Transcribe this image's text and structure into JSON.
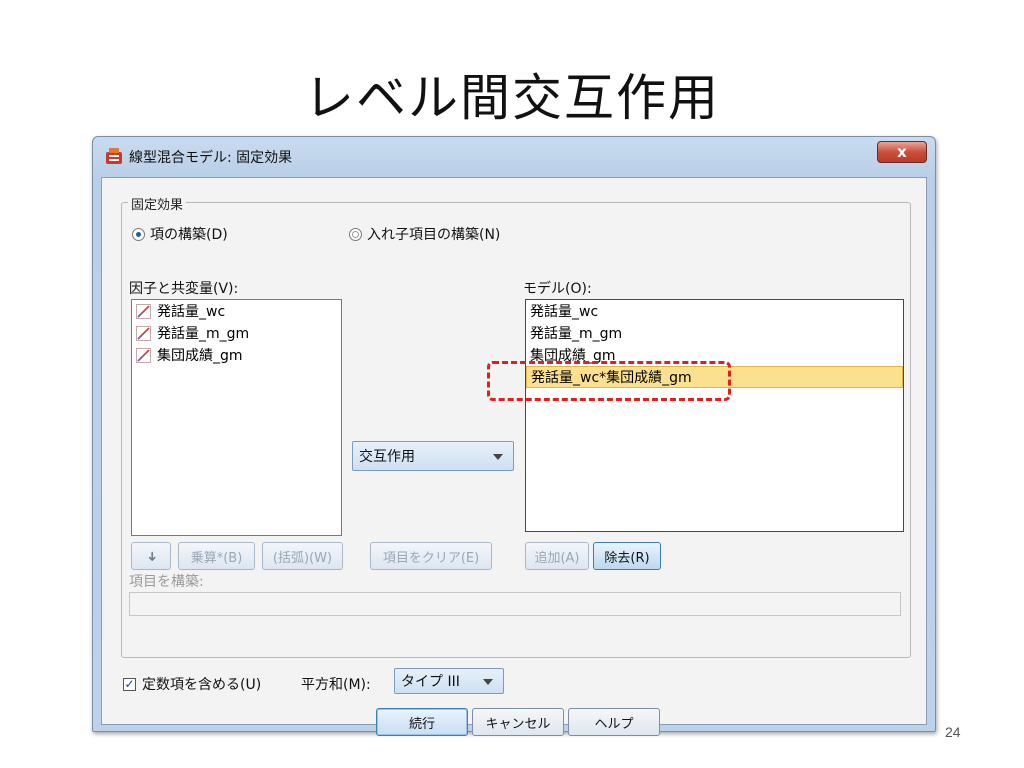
{
  "slide": {
    "title": "レベル間交互作用",
    "page_number": "24"
  },
  "window": {
    "title": "線型混合モデル: 固定効果",
    "close_label": "x"
  },
  "fixed_effects": {
    "group_label": "固定効果",
    "radio_build_terms": {
      "label": "項の構築(D)",
      "selected": true
    },
    "radio_nested_terms": {
      "label": "入れ子項目の構築(N)",
      "selected": false
    },
    "factors_label": "因子と共変量(V):",
    "factors": [
      {
        "label": "発話量_wc",
        "icon": "scale-variable-icon"
      },
      {
        "label": "発話量_m_gm",
        "icon": "scale-variable-icon"
      },
      {
        "label": "集団成績_gm",
        "icon": "scale-variable-icon"
      }
    ],
    "interaction_combo": {
      "value": "交互作用"
    },
    "model_label": "モデル(O):",
    "model_terms": [
      {
        "label": "発話量_wc",
        "selected": false
      },
      {
        "label": "発話量_m_gm",
        "selected": false
      },
      {
        "label": "集団成績_gm",
        "selected": false
      },
      {
        "label": "発話量_wc*集団成績_gm",
        "selected": true
      }
    ],
    "buttons": {
      "move": "➜",
      "multiply": "乗算*(B)",
      "parentheses": "(括弧)(W)",
      "clear_term": "項目をクリア(E)",
      "add": "追加(A)",
      "remove": "除去(R)"
    },
    "build_term_label": "項目を構築:",
    "build_term_value": ""
  },
  "footer": {
    "include_intercept": {
      "label": "定数項を含める(U)",
      "checked": true
    },
    "sum_of_squares_label": "平方和(M):",
    "sum_of_squares_value": "タイプ III",
    "continue": "続行",
    "cancel": "キャンセル",
    "help": "ヘルプ"
  },
  "colors": {
    "highlight_dash": "#e0201a",
    "selected_row": "#fbe08f"
  }
}
